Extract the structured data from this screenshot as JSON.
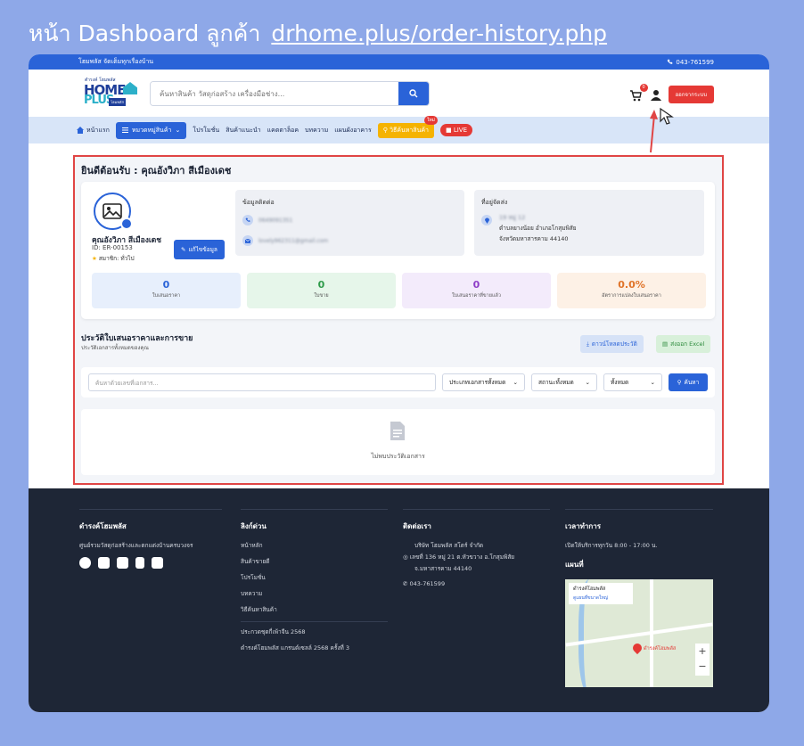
{
  "outer": {
    "title_prefix": "หน้า Dashboard ลูกค้า",
    "url": "drhome.plus/order-history.php"
  },
  "topbar": {
    "tagline": "โฮมพลัส จัดเต็มทุกเรื่องบ้าน",
    "phone": "043-761599"
  },
  "header": {
    "logo_small": "ตำรงค์ โฮมพลัส",
    "logo_home": "HOME",
    "logo_plus": "PLUS",
    "logo_tag": "โฮมพลัส",
    "search_placeholder": "ค้นหาสินค้า วัสดุก่อสร้าง เครื่องมือช่าง...",
    "cart_count": "0",
    "logout_label": "ออกจากระบบ"
  },
  "nav": {
    "home": "หน้าแรก",
    "categories": "หมวดหมู่สินค้า",
    "items": [
      "โปรโมชั่น",
      "สินค้าแนะนำ",
      "แคตตาล็อค",
      "บทความ",
      "แผนผังอาคาร"
    ],
    "howto": "วิธีค้นหาสินค้า",
    "howto_badge": "ใหม่",
    "live": "LIVE"
  },
  "dashboard": {
    "welcome": "ยินดีต้อนรับ : คุณอังวิภา สีเมืองเดช",
    "profile": {
      "name": "คุณอังวิภา สีเมืองเดช",
      "id": "ID: ER-00153",
      "member": "สมาชิก: ทั่วไป",
      "edit_label": "แก้ไขข้อมูล"
    },
    "contact": {
      "title": "ข้อมูลติดต่อ",
      "phone": "0649091351",
      "email": "lovely962311@gmail.com"
    },
    "address": {
      "title": "ที่อยู่จัดส่ง",
      "line1": "19 หมู่ 12",
      "line2": "ตำบลยางน้อย อำเภอโกสุมพิสัย",
      "line3": "จังหวัดมหาสารคาม 44140"
    },
    "stats": [
      {
        "value": "0",
        "label": "ใบเสนอราคา",
        "color": "#2a63d8",
        "bg": "#e7effc"
      },
      {
        "value": "0",
        "label": "ใบขาย",
        "color": "#2e9b4a",
        "bg": "#e6f6ea"
      },
      {
        "value": "0",
        "label": "ใบเสนอราคาที่ขายแล้ว",
        "color": "#8e3fc7",
        "bg": "#f3ebfb"
      },
      {
        "value": "0.0%",
        "label": "อัตราการแปลงใบเสนอราคา",
        "color": "#e0742a",
        "bg": "#fdf1e6"
      }
    ],
    "history": {
      "title": "ประวัติใบเสนอราคาและการขาย",
      "subtitle": "ประวัติเอกสารทั้งหมดของคุณ",
      "download_label": "ดาวน์โหลดประวัติ",
      "excel_label": "ส่งออก Excel",
      "search_placeholder": "ค้นหาด้วยเลขที่เอกสาร...",
      "type_select": "ประเภทเอกสารทั้งหมด",
      "status_select": "สถานะทั้งหมด",
      "period_select": "ทั้งหมด",
      "search_button": "ค้นหา",
      "empty_text": "ไม่พบประวัติเอกสาร"
    }
  },
  "footer": {
    "col1": {
      "title": "ดำรงค์โฮมพลัส",
      "desc": "ศูนย์รวมวัสดุก่อสร้างและตกแต่งบ้านครบวงจร"
    },
    "col2": {
      "title": "ลิงก์ด่วน",
      "links": [
        "หน้าหลัก",
        "สินค้าขายดี",
        "โปรโมชั่น",
        "บทความ",
        "วิธีค้นหาสินค้า"
      ],
      "link_a": "ประกวดชุดกี่เพ้าจีน 2568",
      "link_b": "ดำรงค์โฮมพลัส แกรนด์เซลล์ 2568 ครั้งที่ 3"
    },
    "col3": {
      "title": "ติดต่อเรา",
      "company": "บริษัท โฮมพลัส สโตร์ จำกัด",
      "addr1": "เลขที่ 136 หมู่ 21 ต.หัวขวาง อ.โกสุมพิสัย",
      "addr2": "จ.มหาสารคาม 44140",
      "phone": "043-761599"
    },
    "col4": {
      "title": "เวลาทำการ",
      "hours": "เปิดให้บริการทุกวัน 8:00 - 17:00 น.",
      "map_title": "แผนที่",
      "map_label1": "ดำรงค์โฮมพลัส",
      "map_label2": "ดูแผนที่ขนาดใหญ่",
      "map_pin": "ดำรงค์โฮมพลัส"
    }
  }
}
